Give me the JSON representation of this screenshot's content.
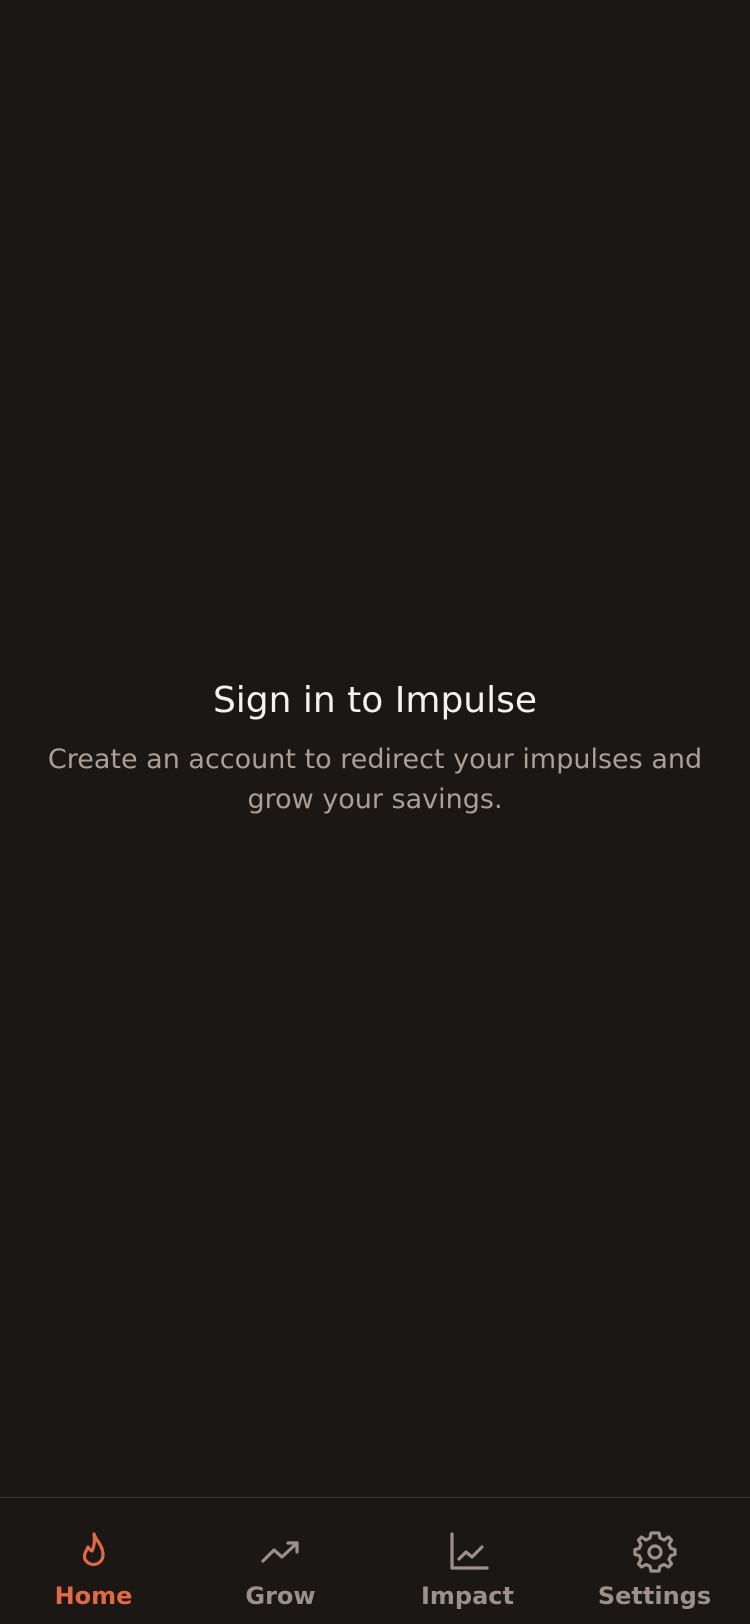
{
  "main": {
    "title": "Sign in to Impulse",
    "subtitle": "Create an account to redirect your impulses and grow your savings."
  },
  "tabbar": {
    "items": [
      {
        "label": "Home",
        "icon": "flame-icon",
        "active": true
      },
      {
        "label": "Grow",
        "icon": "trending-up-icon",
        "active": false
      },
      {
        "label": "Impact",
        "icon": "line-chart-icon",
        "active": false
      },
      {
        "label": "Settings",
        "icon": "gear-icon",
        "active": false
      }
    ]
  },
  "colors": {
    "background": "#1b1715",
    "accent": "#e06a43",
    "inactive": "#9b918a",
    "title": "#f5f1ee",
    "subtitle": "#aa9f97"
  }
}
